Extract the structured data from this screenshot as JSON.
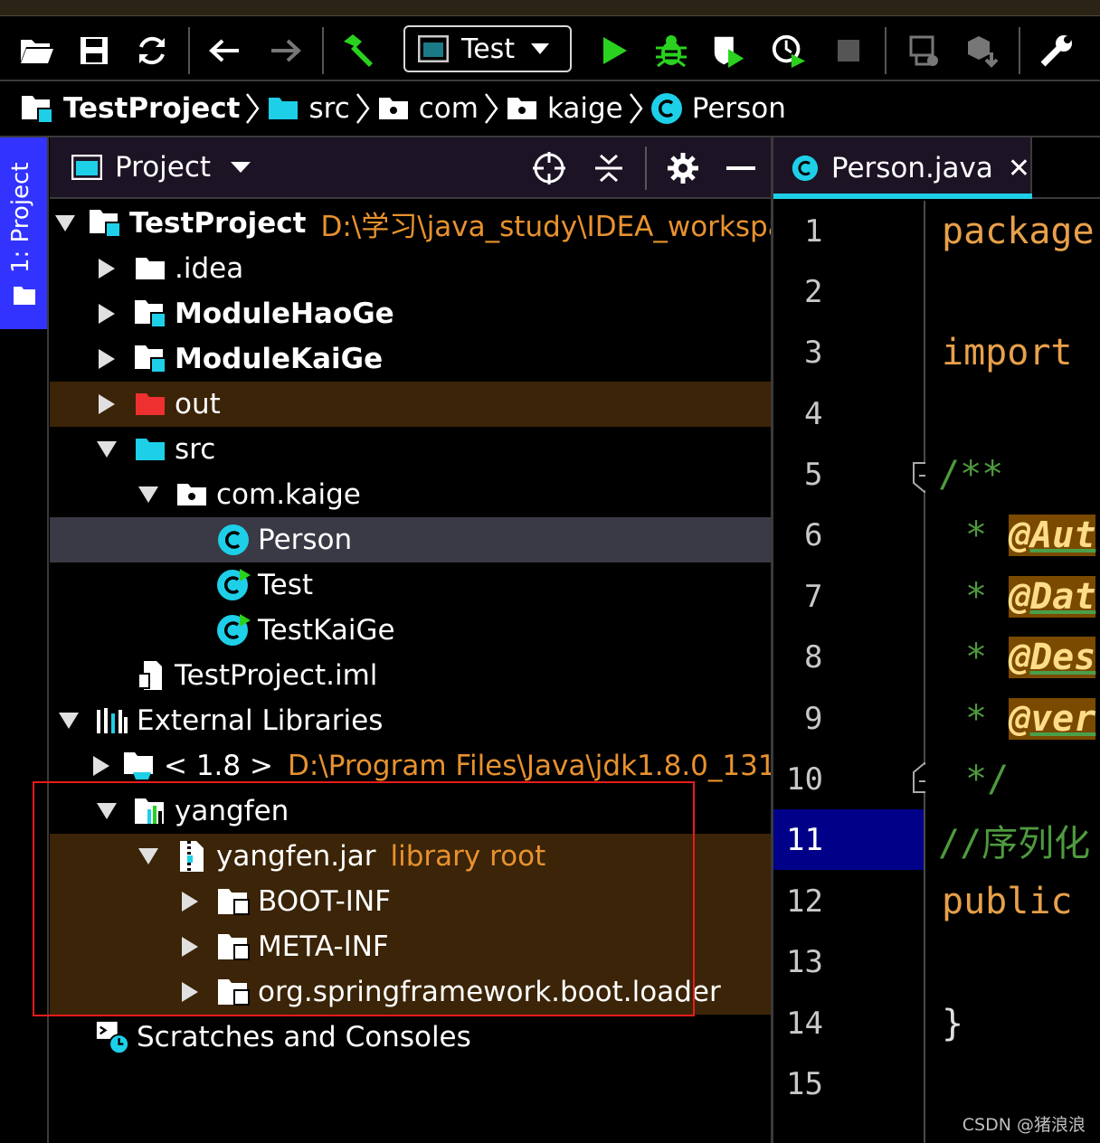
{
  "toolbar": {
    "run_config_label": "Test",
    "icons": [
      "open-folder-icon",
      "save-icon",
      "sync-icon",
      "back-arrow-icon",
      "forward-arrow-icon",
      "build-hammer-icon",
      "run-config-icon",
      "run-icon",
      "debug-icon",
      "coverage-icon",
      "profile-icon",
      "stop-icon",
      "attach-debugger-icon",
      "sdk-icon",
      "settings-wrench-icon"
    ],
    "colors": {
      "run": "#2ad21f",
      "build": "#2ad21f"
    }
  },
  "breadcrumb": [
    {
      "label": "TestProject",
      "icon": "module-folder-icon"
    },
    {
      "label": "src",
      "icon": "source-folder-icon"
    },
    {
      "label": "com",
      "icon": "package-icon"
    },
    {
      "label": "kaige",
      "icon": "package-icon"
    },
    {
      "label": "Person",
      "icon": "class-icon"
    }
  ],
  "left_stripe": {
    "tab_label": "1: Project"
  },
  "project_panel": {
    "title": "Project",
    "tree": [
      {
        "label": "TestProject",
        "path": "D:\\学习\\java_study\\IDEA_workspace\\"
      },
      {
        "label": ".idea"
      },
      {
        "label": "ModuleHaoGe"
      },
      {
        "label": "ModuleKaiGe"
      },
      {
        "label": "out"
      },
      {
        "label": "src"
      },
      {
        "label": "com.kaige"
      },
      {
        "label": "Person"
      },
      {
        "label": "Test"
      },
      {
        "label": "TestKaiGe"
      },
      {
        "label": "TestProject.iml"
      },
      {
        "label": "External Libraries"
      },
      {
        "label": "< 1.8 >",
        "path": "D:\\Program Files\\Java\\jdk1.8.0_131"
      },
      {
        "label": "yangfen"
      },
      {
        "label": "yangfen.jar",
        "path": "library root"
      },
      {
        "label": "BOOT-INF"
      },
      {
        "label": "META-INF"
      },
      {
        "label": "org.springframework.boot.loader"
      },
      {
        "label": "Scratches and Consoles"
      }
    ]
  },
  "editor": {
    "tab_label": "Person.java",
    "close_glyph": "✕",
    "line_numbers": [
      "1",
      "2",
      "3",
      "4",
      "5",
      "6",
      "7",
      "8",
      "9",
      "10",
      "11",
      "12",
      "13",
      "14",
      "15"
    ],
    "code": {
      "l1": "package",
      "l3": "import",
      "l5": "/**",
      "star": "*",
      "l6a": "@Aut",
      "l7a": "@Dat",
      "l8a": "@Des",
      "l9a": "@ver",
      "l10": "*/",
      "l11": "//序列化",
      "l12": "public",
      "l14": "}"
    }
  },
  "watermark": "CSDN @猪浪浪"
}
